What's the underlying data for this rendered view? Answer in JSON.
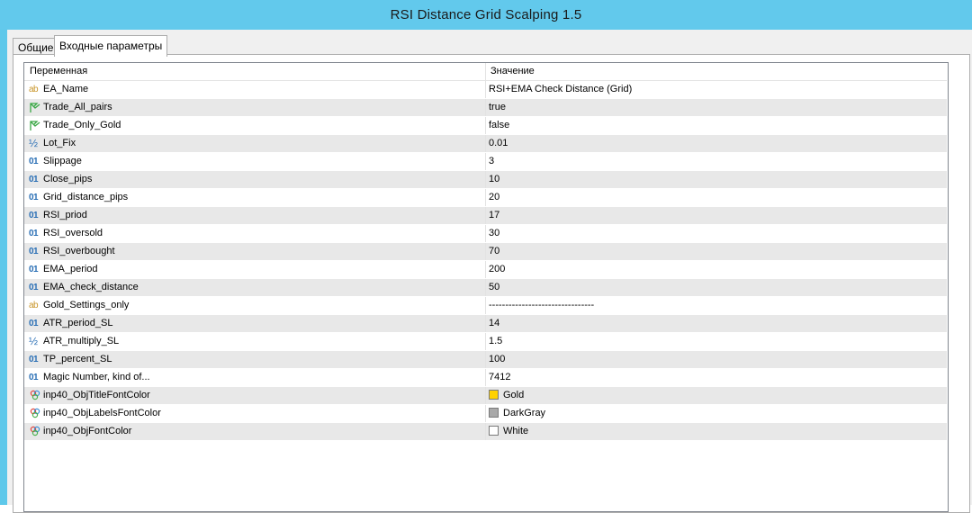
{
  "window": {
    "title": "RSI Distance Grid Scalping 1.5"
  },
  "tabs": [
    {
      "label": "Общие",
      "active": false
    },
    {
      "label": "Входные параметры",
      "active": true
    }
  ],
  "table": {
    "columns": {
      "name": "Переменная",
      "value": "Значение"
    },
    "rows": [
      {
        "icon": "string-type-icon",
        "name": "EA_Name",
        "value": "RSI+EMA Check Distance (Grid)"
      },
      {
        "icon": "bool-type-icon",
        "name": "Trade_All_pairs",
        "value": "true"
      },
      {
        "icon": "bool-type-icon",
        "name": "Trade_Only_Gold",
        "value": "false"
      },
      {
        "icon": "double-type-icon",
        "name": "Lot_Fix",
        "value": "0.01"
      },
      {
        "icon": "int-type-icon",
        "name": "Slippage",
        "value": "3"
      },
      {
        "icon": "int-type-icon",
        "name": "Close_pips",
        "value": "10"
      },
      {
        "icon": "int-type-icon",
        "name": "Grid_distance_pips",
        "value": "20"
      },
      {
        "icon": "int-type-icon",
        "name": "RSI_priod",
        "value": "17"
      },
      {
        "icon": "int-type-icon",
        "name": "RSI_oversold",
        "value": "30"
      },
      {
        "icon": "int-type-icon",
        "name": "RSI_overbought",
        "value": "70"
      },
      {
        "icon": "int-type-icon",
        "name": "EMA_period",
        "value": "200"
      },
      {
        "icon": "int-type-icon",
        "name": "EMA_check_distance",
        "value": "50"
      },
      {
        "icon": "string-type-icon",
        "name": "Gold_Settings_only",
        "value": "--------------------------------"
      },
      {
        "icon": "int-type-icon",
        "name": "ATR_period_SL",
        "value": "14"
      },
      {
        "icon": "double-type-icon",
        "name": "ATR_multiply_SL",
        "value": "1.5"
      },
      {
        "icon": "int-type-icon",
        "name": "TP_percent_SL",
        "value": "100"
      },
      {
        "icon": "int-type-icon",
        "name": "Magic Number, kind of...",
        "value": "7412"
      },
      {
        "icon": "color-type-icon",
        "name": "inp40_ObjTitleFontColor",
        "value": "Gold",
        "swatch": "#ffd200"
      },
      {
        "icon": "color-type-icon",
        "name": "inp40_ObjLabelsFontColor",
        "value": "DarkGray",
        "swatch": "#a9a9a9"
      },
      {
        "icon": "color-type-icon",
        "name": "inp40_ObjFontColor",
        "value": "White",
        "swatch": "#ffffff"
      }
    ]
  },
  "icon_glyphs": {
    "string": "ab",
    "int": "01",
    "double": "½"
  },
  "colors": {
    "titlebar": "#62c9ec",
    "row_alt": "#e8e8e8",
    "string_icon": "#c9962b",
    "int_icon": "#2a6fb5",
    "bool_icon": "#3aa845"
  }
}
